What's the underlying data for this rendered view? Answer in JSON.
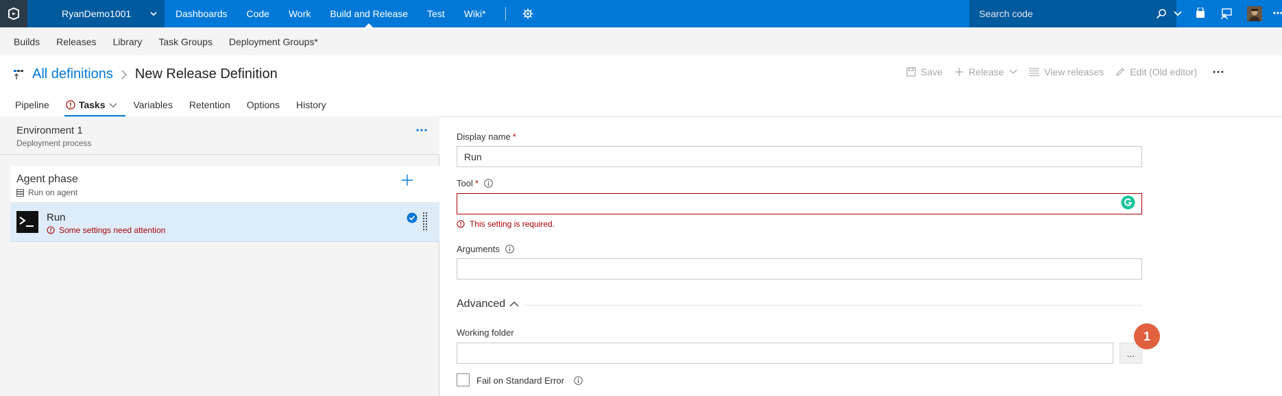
{
  "topbar": {
    "account": "RyanDemo1001",
    "nav": [
      "Dashboards",
      "Code",
      "Work",
      "Build and Release",
      "Test",
      "Wiki*"
    ],
    "search_placeholder": "Search code"
  },
  "subnav": [
    "Builds",
    "Releases",
    "Library",
    "Task Groups",
    "Deployment Groups*"
  ],
  "header": {
    "breadcrumb_root": "All definitions",
    "title": "New Release Definition",
    "actions": {
      "save": "Save",
      "release": "Release",
      "view_releases": "View releases",
      "edit_old": "Edit (Old editor)"
    }
  },
  "tabs": [
    "Pipeline",
    "Tasks",
    "Variables",
    "Retention",
    "Options",
    "History"
  ],
  "left": {
    "environment": {
      "name": "Environment 1",
      "sub": "Deployment process"
    },
    "phase": {
      "name": "Agent phase",
      "sub": "Run on agent"
    },
    "task": {
      "name": "Run",
      "warning": "Some settings need attention"
    }
  },
  "form": {
    "display_name_label": "Display name",
    "display_name_value": "Run",
    "tool_label": "Tool",
    "tool_value": "",
    "tool_error": "This setting is required.",
    "arguments_label": "Arguments",
    "arguments_value": "",
    "advanced_label": "Advanced",
    "working_folder_label": "Working folder",
    "working_folder_value": "",
    "browse_label": "...",
    "fail_label": "Fail on Standard Error",
    "badge": "1",
    "required_mark": "*"
  },
  "colors": {
    "brand": "#0078d7",
    "error": "#a80000",
    "badge": "#e0603f"
  }
}
